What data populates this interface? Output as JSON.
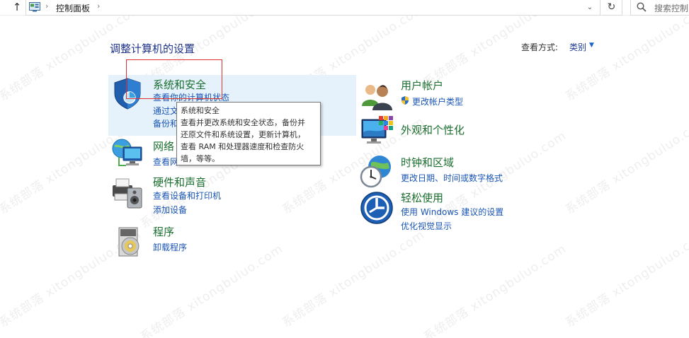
{
  "address_bar": {
    "breadcrumb": "控制面板",
    "search_placeholder": "搜索控制"
  },
  "header": {
    "title": "调整计算机的设置",
    "view_by_label": "查看方式:",
    "view_by_value": "类别"
  },
  "categories": {
    "system_security": {
      "title": "系统和安全",
      "links": [
        "查看你的计算机状态",
        "通过文",
        "备份和"
      ]
    },
    "network": {
      "title": "网络",
      "links": [
        "查看网"
      ]
    },
    "hardware": {
      "title": "硬件和声音",
      "links": [
        "查看设备和打印机",
        "添加设备"
      ]
    },
    "programs": {
      "title": "程序",
      "links": [
        "卸载程序"
      ]
    },
    "user_accounts": {
      "title": "用户帐户",
      "links": [
        "更改帐户类型"
      ]
    },
    "appearance": {
      "title": "外观和个性化",
      "links": []
    },
    "clock_region": {
      "title": "时钟和区域",
      "links": [
        "更改日期、时间或数字格式"
      ]
    },
    "ease_of_access": {
      "title": "轻松使用",
      "links": [
        "使用 Windows 建议的设置",
        "优化视觉显示"
      ]
    }
  },
  "tooltip": {
    "lines": [
      "系统和安全",
      "查看并更改系统和安全状态，备份并",
      "还原文件和系统设置，更新计算机，",
      "查看 RAM 和处理器速度和检查防火",
      "墙，等等。"
    ]
  },
  "watermark": "系统部落 xitongbuluo.com",
  "colors": {
    "category_title": "#1a6e2e",
    "link": "#1a55b4",
    "hover_bg": "#e5f1fb",
    "highlight_box": "#e03030"
  }
}
